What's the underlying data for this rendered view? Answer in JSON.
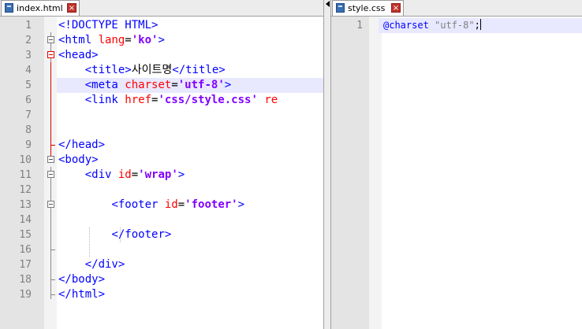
{
  "left_editor": {
    "tab": {
      "label": "index.html",
      "icon": "html-file-icon",
      "close": "×"
    },
    "active_line": 5,
    "lines": [
      {
        "num": "1",
        "segs": [
          {
            "t": "<!DOCTYPE HTML>",
            "c": "tg"
          }
        ]
      },
      {
        "num": "2",
        "segs": [
          {
            "t": "<html ",
            "c": "tg"
          },
          {
            "t": "lang",
            "c": "at"
          },
          {
            "t": "=",
            "c": "tx"
          },
          {
            "t": "'ko'",
            "c": "vl"
          },
          {
            "t": ">",
            "c": "tg"
          }
        ]
      },
      {
        "num": "3",
        "segs": [
          {
            "t": "<head>",
            "c": "tg"
          }
        ]
      },
      {
        "num": "4",
        "segs": [
          {
            "t": "    ",
            "c": "tx"
          },
          {
            "t": "<title>",
            "c": "tg"
          },
          {
            "t": "사이트명",
            "c": "tx"
          },
          {
            "t": "</title>",
            "c": "tg"
          }
        ]
      },
      {
        "num": "5",
        "segs": [
          {
            "t": "    ",
            "c": "tx"
          },
          {
            "t": "<meta ",
            "c": "tg"
          },
          {
            "t": "charset",
            "c": "at"
          },
          {
            "t": "=",
            "c": "tx"
          },
          {
            "t": "'utf-8'",
            "c": "vl"
          },
          {
            "t": ">",
            "c": "tg"
          }
        ]
      },
      {
        "num": "6",
        "segs": [
          {
            "t": "    ",
            "c": "tx"
          },
          {
            "t": "<link ",
            "c": "tg"
          },
          {
            "t": "href",
            "c": "at"
          },
          {
            "t": "=",
            "c": "tx"
          },
          {
            "t": "'css/style.css'",
            "c": "vl"
          },
          {
            "t": " ",
            "c": "tx"
          },
          {
            "t": "re",
            "c": "at"
          }
        ]
      },
      {
        "num": "7",
        "segs": []
      },
      {
        "num": "8",
        "segs": []
      },
      {
        "num": "9",
        "segs": [
          {
            "t": "</head>",
            "c": "tg"
          }
        ]
      },
      {
        "num": "10",
        "segs": [
          {
            "t": "<body>",
            "c": "tg"
          }
        ]
      },
      {
        "num": "11",
        "segs": [
          {
            "t": "    ",
            "c": "tx"
          },
          {
            "t": "<div ",
            "c": "tg"
          },
          {
            "t": "id",
            "c": "at"
          },
          {
            "t": "=",
            "c": "tx"
          },
          {
            "t": "'wrap'",
            "c": "vl"
          },
          {
            "t": ">",
            "c": "tg"
          }
        ]
      },
      {
        "num": "12",
        "segs": []
      },
      {
        "num": "13",
        "segs": [
          {
            "t": "        ",
            "c": "tx"
          },
          {
            "t": "<footer ",
            "c": "tg"
          },
          {
            "t": "id",
            "c": "at"
          },
          {
            "t": "=",
            "c": "tx"
          },
          {
            "t": "'footer'",
            "c": "vl"
          },
          {
            "t": ">",
            "c": "tg"
          }
        ]
      },
      {
        "num": "14",
        "segs": []
      },
      {
        "num": "15",
        "segs": [
          {
            "t": "        ",
            "c": "tx"
          },
          {
            "t": "</footer>",
            "c": "tg"
          }
        ]
      },
      {
        "num": "16",
        "segs": []
      },
      {
        "num": "17",
        "segs": [
          {
            "t": "    ",
            "c": "tx"
          },
          {
            "t": "</div>",
            "c": "tg"
          }
        ]
      },
      {
        "num": "18",
        "segs": [
          {
            "t": "</body>",
            "c": "tg"
          }
        ]
      },
      {
        "num": "19",
        "segs": [
          {
            "t": "</html>",
            "c": "tg"
          }
        ]
      }
    ]
  },
  "right_editor": {
    "tab": {
      "label": "style.css",
      "icon": "css-file-icon",
      "close": "×"
    },
    "active_line": 1,
    "lines": [
      {
        "num": "1",
        "segs": [
          {
            "t": "@charset",
            "c": "css-at"
          },
          {
            "t": " ",
            "c": "tx"
          },
          {
            "t": "\"utf-8\"",
            "c": "css-str"
          },
          {
            "t": ";",
            "c": "tx"
          }
        ]
      }
    ]
  },
  "colors": {
    "tag": "#0000ff",
    "attr": "#ff0000",
    "value": "#8000ff",
    "line_highlight": "#e8e8ff",
    "fold_active": "#dd0000"
  }
}
